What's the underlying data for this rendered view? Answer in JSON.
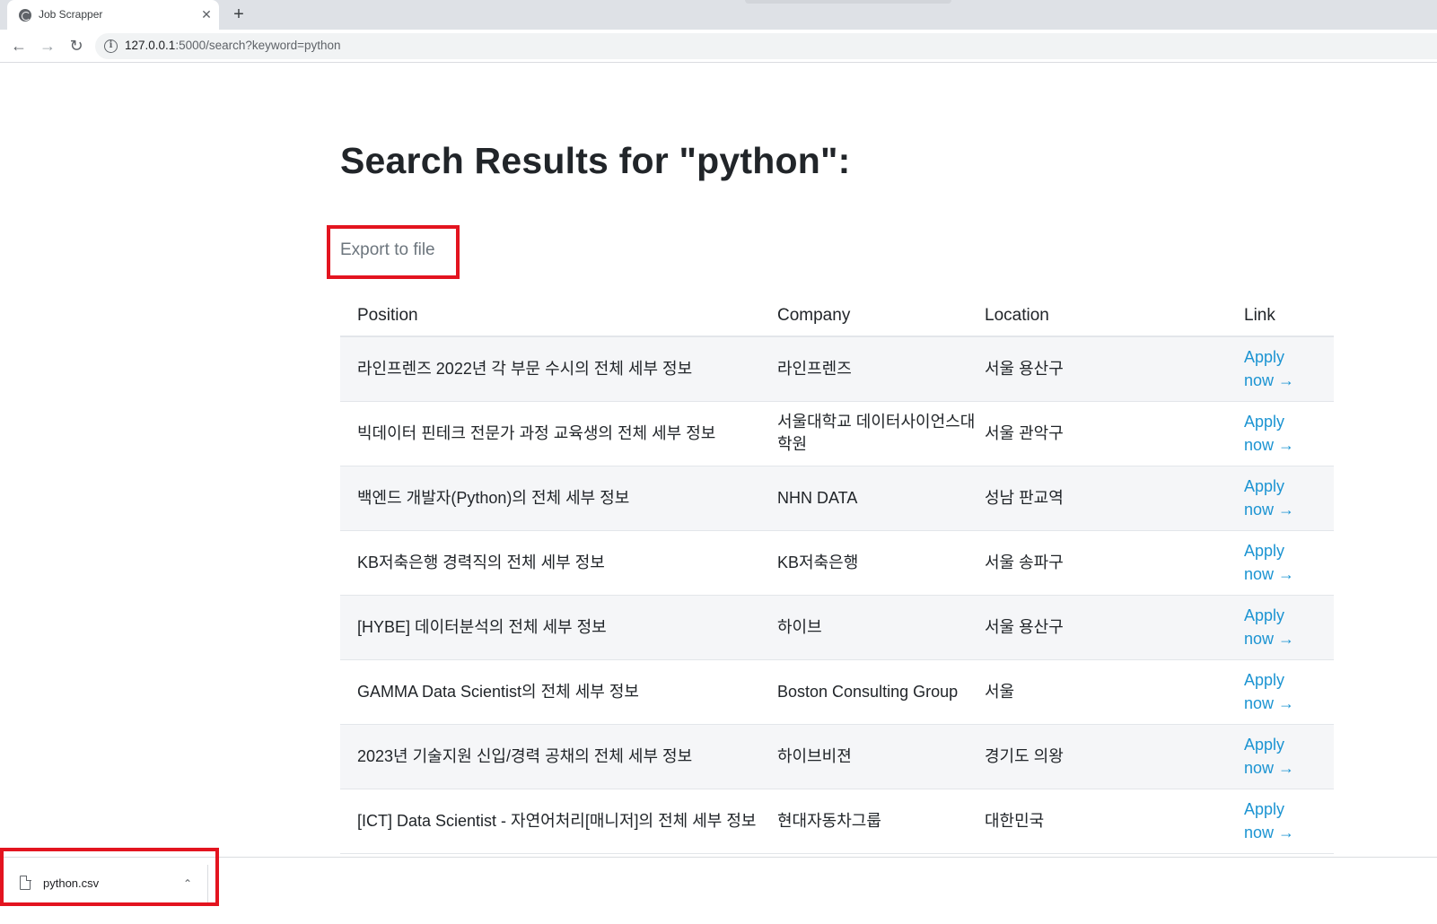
{
  "browser": {
    "tab_title": "Job Scrapper",
    "tab_close": "✕",
    "new_tab": "+",
    "back": "←",
    "forward": "→",
    "reload": "↻",
    "info": "i",
    "url_host": "127.0.0.1",
    "url_rest": ":5000/search?keyword=python"
  },
  "page": {
    "title": "Search Results for \"python\":",
    "export_label": "Export to file"
  },
  "table": {
    "headers": {
      "position": "Position",
      "company": "Company",
      "location": "Location",
      "link": "Link"
    },
    "apply_label": "Apply now →",
    "rows": [
      {
        "position": "라인프렌즈 2022년 각 부문 수시의 전체 세부 정보",
        "company": "라인프렌즈",
        "location": "서울 용산구"
      },
      {
        "position": "빅데이터 핀테크 전문가 과정 교육생의 전체 세부 정보",
        "company": "서울대학교 데이터사이언스대학원",
        "location": "서울 관악구"
      },
      {
        "position": "백엔드 개발자(Python)의 전체 세부 정보",
        "company": "NHN DATA",
        "location": "성남 판교역"
      },
      {
        "position": "KB저축은행 경력직의 전체 세부 정보",
        "company": "KB저축은행",
        "location": "서울 송파구"
      },
      {
        "position": "[HYBE] 데이터분석의 전체 세부 정보",
        "company": "하이브",
        "location": "서울 용산구"
      },
      {
        "position": "GAMMA Data Scientist의 전체 세부 정보",
        "company": "Boston Consulting Group",
        "location": "서울"
      },
      {
        "position": "2023년 기술지원 신입/경력 공채의 전체 세부 정보",
        "company": "하이브비젼",
        "location": "경기도 의왕"
      },
      {
        "position": "[ICT] Data Scientist - 자연어처리[매니저]의 전체 세부 정보",
        "company": "현대자동차그룹",
        "location": "대한민국"
      }
    ]
  },
  "downloads": {
    "file_name": "python.csv",
    "chevron": "⌃"
  },
  "colors": {
    "highlight": "#e3141f",
    "link": "#1c94d2",
    "row_stripe": "#f5f6f8"
  }
}
